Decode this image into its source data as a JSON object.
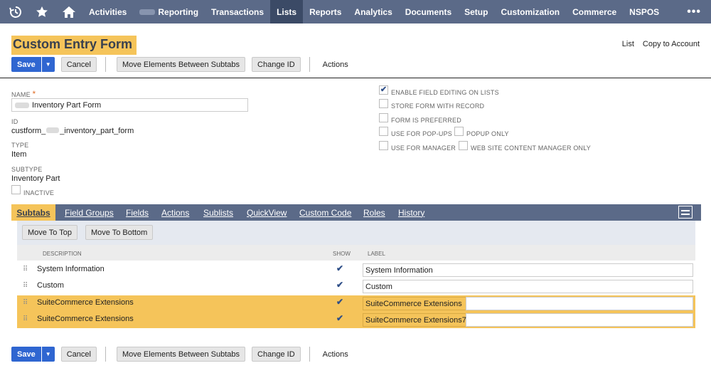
{
  "nav": {
    "items": [
      "Activities",
      "Reporting",
      "Transactions",
      "Lists",
      "Reports",
      "Analytics",
      "Documents",
      "Setup",
      "Customization",
      "Commerce",
      "NSPOS"
    ],
    "active": "Lists",
    "more": "•••"
  },
  "page": {
    "title": "Custom Entry Form",
    "links": {
      "list": "List",
      "copy": "Copy to Account"
    }
  },
  "toolbar": {
    "save": "Save",
    "cancel": "Cancel",
    "move": "Move Elements Between Subtabs",
    "change_id": "Change ID",
    "actions": "Actions"
  },
  "fields": {
    "name_label": "NAME",
    "name_required": "*",
    "name_value": "Inventory Part Form",
    "id_label": "ID",
    "id_prefix": "custform_",
    "id_suffix": "_inventory_part_form",
    "type_label": "TYPE",
    "type_value": "Item",
    "subtype_label": "SUBTYPE",
    "subtype_value": "Inventory Part",
    "inactive_label": "INACTIVE"
  },
  "options": {
    "enable_field_editing": {
      "label": "ENABLE FIELD EDITING ON LISTS",
      "checked": true
    },
    "store_form": {
      "label": "STORE FORM WITH RECORD",
      "checked": false
    },
    "preferred": {
      "label": "FORM IS PREFERRED",
      "checked": false
    },
    "popups": {
      "label": "USE FOR POP-UPS",
      "checked": false
    },
    "popup_only": {
      "label": "POPUP ONLY",
      "checked": false
    },
    "manager": {
      "label": "USE FOR MANAGER",
      "checked": false
    },
    "website_manager": {
      "label": "WEB SITE CONTENT MANAGER ONLY",
      "checked": false
    }
  },
  "tabs": [
    {
      "label": "Subtabs",
      "active": true
    },
    {
      "label": "Field Groups"
    },
    {
      "label": "Fields"
    },
    {
      "label": "Actions"
    },
    {
      "label": "Sublists"
    },
    {
      "label": "QuickView"
    },
    {
      "label": "Custom Code"
    },
    {
      "label": "Roles"
    },
    {
      "label": "History"
    }
  ],
  "subtab_panel": {
    "move_top": "Move To Top",
    "move_bottom": "Move To Bottom",
    "columns": {
      "description": "DESCRIPTION",
      "show": "SHOW",
      "label": "LABEL"
    },
    "rows": [
      {
        "description": "System Information",
        "show": true,
        "label": "System Information",
        "highlight": false
      },
      {
        "description": "Custom",
        "show": true,
        "label": "Custom",
        "highlight": false
      },
      {
        "description": "SuiteCommerce Extensions",
        "show": true,
        "label": "SuiteCommerce Extensions",
        "highlight": true
      },
      {
        "description": "SuiteCommerce Extensions",
        "show": true,
        "label": "SuiteCommerce Extensions7",
        "highlight": true
      }
    ]
  },
  "colors": {
    "nav": "#5b6a88",
    "nav_active": "#3b4a66",
    "highlight": "#f5c45a",
    "save": "#2f66d1"
  }
}
